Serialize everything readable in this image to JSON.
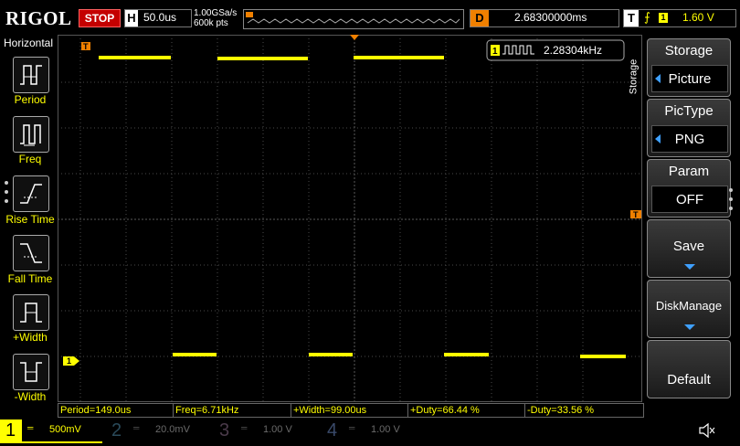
{
  "header": {
    "logo": "RIGOL",
    "run_state": "STOP",
    "timebase_label": "H",
    "timebase": "50.0us",
    "sample_rate": "1.00GSa/s",
    "memory_depth": "600k pts",
    "delay_label": "D",
    "delay": "2.68300000ms",
    "trigger_label": "T",
    "trigger_source": "1",
    "trigger_level": "1.60 V"
  },
  "left_panel": {
    "title": "Horizontal",
    "items": [
      {
        "label": "Period",
        "icon": "period-icon"
      },
      {
        "label": "Freq",
        "icon": "freq-icon"
      },
      {
        "label": "Rise Time",
        "icon": "rise-time-icon"
      },
      {
        "label": "Fall Time",
        "icon": "fall-time-icon"
      },
      {
        "label": "+Width",
        "icon": "pos-width-icon"
      },
      {
        "label": "-Width",
        "icon": "neg-width-icon"
      }
    ]
  },
  "waveform": {
    "frequency_counter_channel": "1",
    "frequency_counter": "2.28304kHz",
    "trigger_marker": "T",
    "channel_marker": "1",
    "color": "#ffff00"
  },
  "right_panel": {
    "side_label": "Storage",
    "buttons": [
      {
        "title": "Storage",
        "value": "Picture"
      },
      {
        "title": "PicType",
        "value": "PNG"
      },
      {
        "title": "Param",
        "value": "OFF"
      },
      {
        "title": "Save"
      },
      {
        "title": "DiskManage"
      },
      {
        "title": "Default"
      }
    ]
  },
  "measurements": [
    "Period=149.0us",
    "Freq=6.71kHz",
    "+Width=99.00us",
    "+Duty=66.44 %",
    "-Duty=33.56 %"
  ],
  "channels": [
    {
      "num": "1",
      "scale": "500mV",
      "color": "#ffff00",
      "active": true
    },
    {
      "num": "2",
      "scale": "20.0mV",
      "color": "#00c0ff",
      "active": false
    },
    {
      "num": "3",
      "scale": "1.00 V",
      "color": "#ff40ff",
      "active": false
    },
    {
      "num": "4",
      "scale": "1.00 V",
      "color": "#3060ff",
      "active": false
    }
  ]
}
